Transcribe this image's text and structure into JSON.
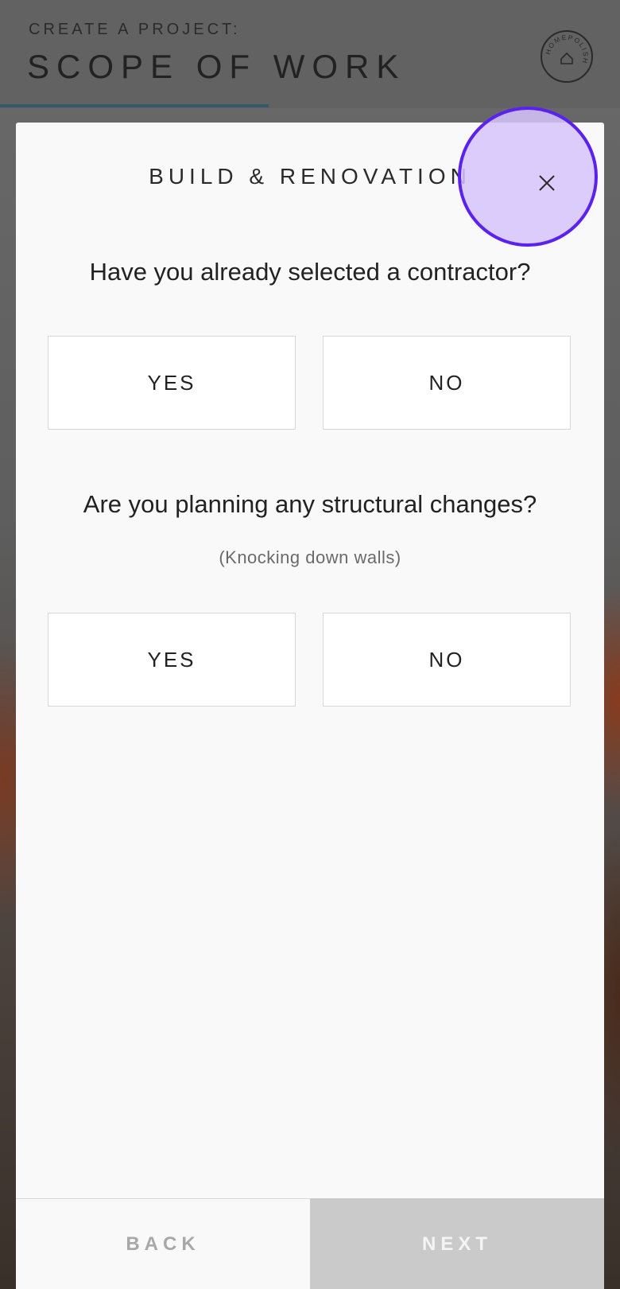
{
  "header": {
    "eyebrow": "CREATE A PROJECT:",
    "title": "SCOPE OF WORK",
    "logo_text": "HOMEPOLISH",
    "progress_fraction": 0.43
  },
  "modal": {
    "title": "BUILD & RENOVATION",
    "close_icon": "close-icon",
    "questions": [
      {
        "text": "Have you already selected a contractor?",
        "options": [
          "YES",
          "NO"
        ]
      },
      {
        "text": "Are you planning any structural changes?",
        "subtext": "(Knocking down walls)",
        "options": [
          "YES",
          "NO"
        ]
      }
    ],
    "footer": {
      "back_label": "BACK",
      "next_label": "NEXT"
    }
  },
  "colors": {
    "highlight_border": "#5b21ee",
    "highlight_fill": "#d6c4fc",
    "progress": "#2f5b6b"
  }
}
